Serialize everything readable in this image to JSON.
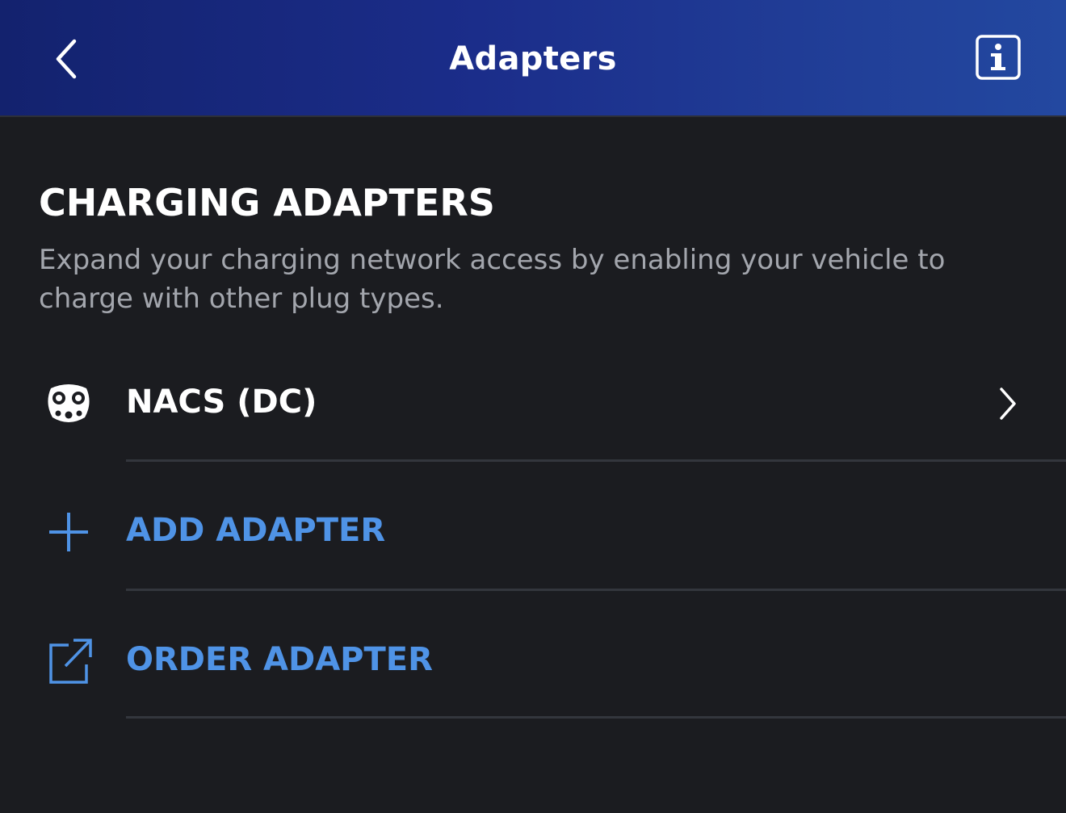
{
  "header": {
    "title": "Adapters",
    "back_icon": "chevron-left-icon",
    "info_icon": "info-icon",
    "gradient_start": "#13226e",
    "gradient_end": "#2348a0"
  },
  "section": {
    "title": "CHARGING ADAPTERS",
    "description": "Expand your charging network access by enabling your vehicle to charge with other plug types."
  },
  "adapters": [
    {
      "label": "NACS (DC)",
      "icon": "nacs-plug-icon",
      "trailing_icon": "chevron-right-icon"
    }
  ],
  "actions": {
    "add": {
      "label": "ADD ADAPTER",
      "icon": "plus-icon"
    },
    "order": {
      "label": "ORDER ADAPTER",
      "icon": "external-link-icon"
    }
  },
  "colors": {
    "background": "#1b1c20",
    "accent_blue": "#4f93e6",
    "secondary_text": "#a3a6ad",
    "divider": "#33363d"
  }
}
